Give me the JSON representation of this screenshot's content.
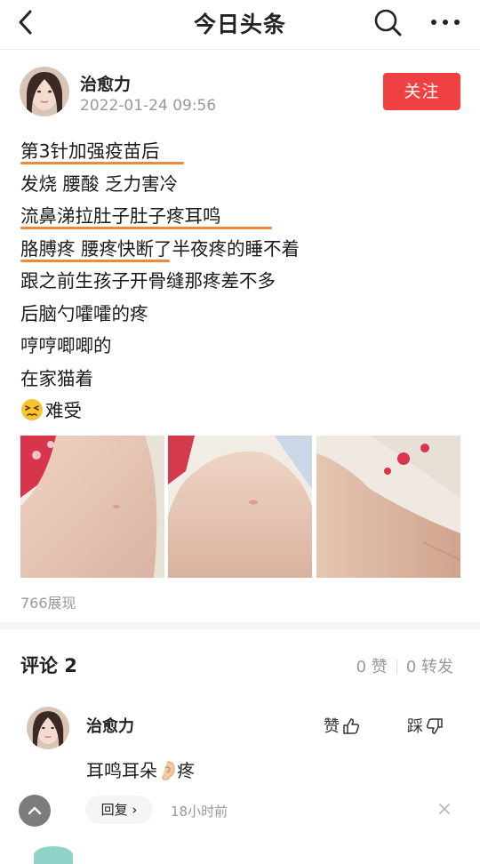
{
  "nav": {
    "title": "今日头条"
  },
  "post": {
    "author": "治愈力",
    "timestamp": "2022-01-24 09:56",
    "follow_label": "关注",
    "lines": [
      "第3针加强疫苗后",
      "发烧 腰酸 乏力害冷",
      "流鼻涕拉肚子肚子疼耳鸣",
      "胳膊疼 腰疼快断了半夜疼的睡不着",
      "跟之前生孩子开骨缝那疼差不多",
      "后脑勺嚯嚯的疼",
      "哼哼唧唧的",
      "在家猫着",
      "难受"
    ],
    "impressions": "766展现"
  },
  "comments": {
    "title": "评论 2",
    "likes": "0 赞",
    "shares": "0 转发",
    "items": [
      {
        "author": "治愈力",
        "like_label": "赞",
        "dislike_label": "踩",
        "text_before": "耳鸣耳朵",
        "text_after": "疼",
        "reply_label": "回复 ›",
        "time": "18小时前"
      }
    ]
  },
  "icons": {
    "back": "chevron-left-icon",
    "search": "search-icon",
    "more": "more-dots-icon",
    "emoji": "persevering-face-emoji",
    "ear": "ear-emoji",
    "like": "thumbs-up-icon",
    "dislike": "thumbs-down-icon",
    "close": "close-icon",
    "scroll_top": "chevron-up-icon"
  },
  "colors": {
    "follow": "#f04142",
    "underline": "#ec8a3a",
    "muted": "#999999"
  }
}
